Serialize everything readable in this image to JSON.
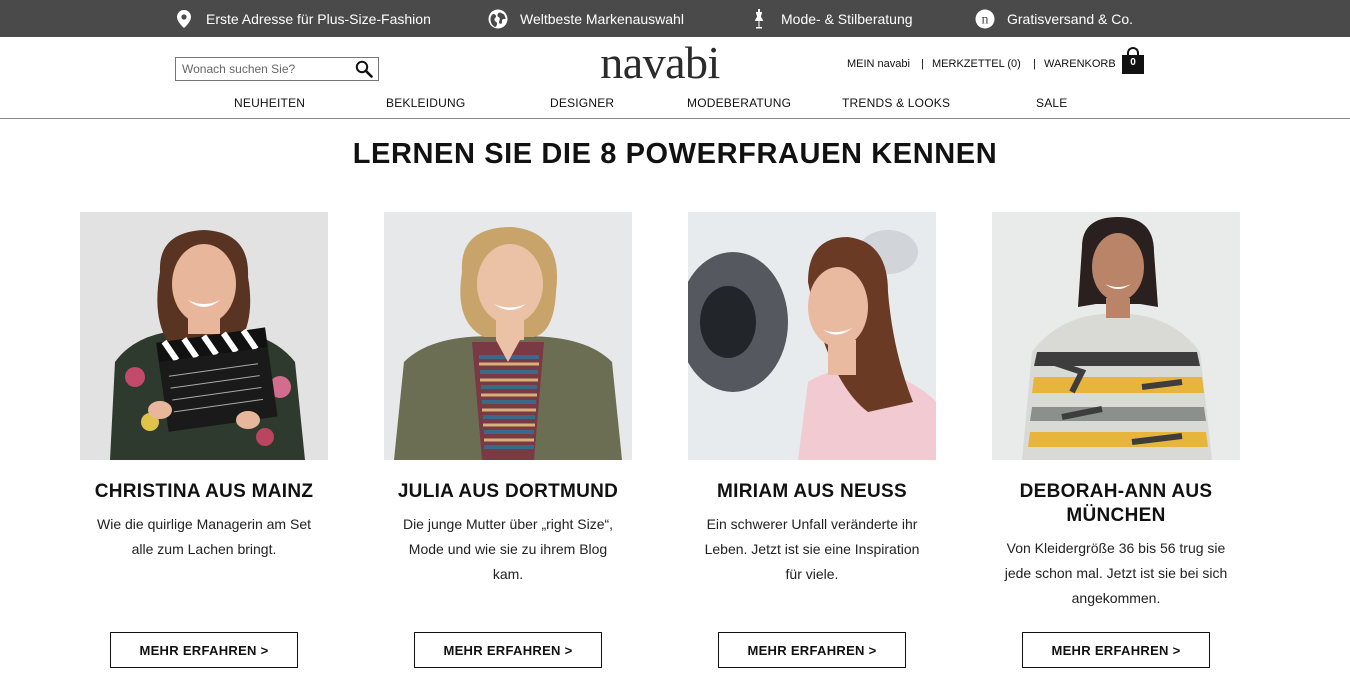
{
  "topbar": {
    "bg_color": "#4a4a4a",
    "items": [
      {
        "icon": "location-pin-icon",
        "label": "Erste Adresse für Plus-Size-Fashion"
      },
      {
        "icon": "globe-icon",
        "label": "Weltbeste Markenauswahl"
      },
      {
        "icon": "dress-form-icon",
        "label": "Mode- & Stilberatung"
      },
      {
        "icon": "navabi-n-icon",
        "label": "Gratisversand & Co."
      }
    ]
  },
  "header": {
    "search": {
      "placeholder": "Wonach suchen Sie?",
      "value": "",
      "icon": "search-icon"
    },
    "logo": "navabi",
    "account": {
      "mein": "MEIN navabi",
      "separator": "|",
      "merkzettel": "MERKZETTEL (0)",
      "warenkorb": "WARENKORB",
      "cart_count": "0",
      "cart_icon": "shopping-bag-icon"
    }
  },
  "nav": {
    "items": [
      "NEUHEITEN",
      "BEKLEIDUNG",
      "DESIGNER",
      "MODEBERATUNG",
      "TRENDS & LOOKS",
      "SALE"
    ]
  },
  "main": {
    "heading": "LERNEN SIE DIE 8 POWERFRAUEN KENNEN",
    "cards": [
      {
        "name": "CHRISTINA AUS MAINZ",
        "description": "Wie die quirlige Managerin am Set alle zum Lachen bringt.",
        "button": "MEHR ERFAHREN >"
      },
      {
        "name": "JULIA AUS DORTMUND",
        "description": "Die junge Mutter über „right Size“, Mode und wie sie zu ihrem Blog kam.",
        "button": "MEHR ERFAHREN >"
      },
      {
        "name": "MIRIAM AUS NEUSS",
        "description": "Ein schwerer Unfall veränderte ihr Leben. Jetzt ist sie eine Inspiration für viele.",
        "button": "MEHR ERFAHREN >"
      },
      {
        "name": "DEBORAH-ANN AUS MÜNCHEN",
        "description": "Von Kleidergröße 36 bis 56 trug sie jede schon mal. Jetzt ist sie bei sich angekommen.",
        "button": "MEHR ERFAHREN >"
      }
    ]
  }
}
